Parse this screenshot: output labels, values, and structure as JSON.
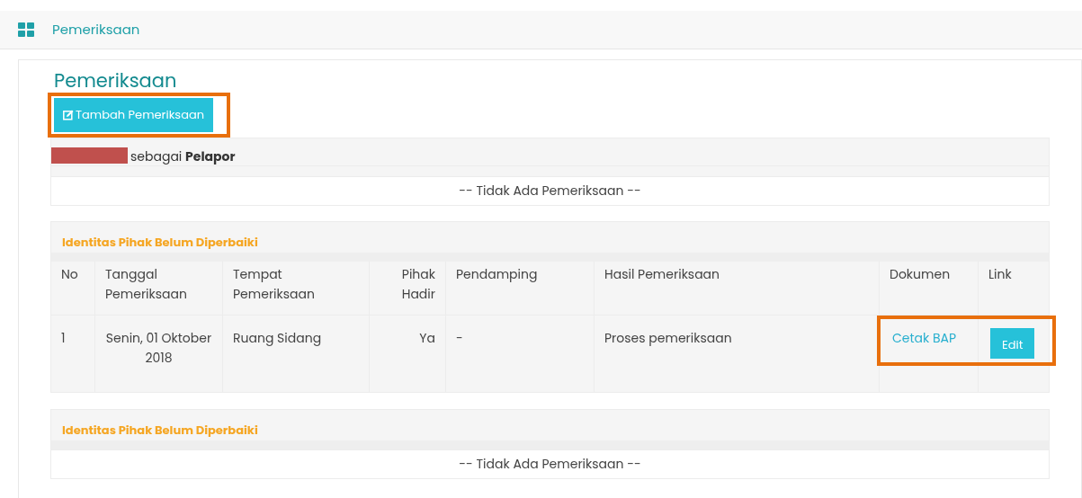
{
  "breadcrumb": {
    "label": "Pemeriksaan"
  },
  "page": {
    "title": "Pemeriksaan",
    "add_button": {
      "label": "Tambah Pemeriksaan",
      "highlighted": true
    }
  },
  "reporter": {
    "redacted": true,
    "text": "sebagai **Pelapor**",
    "empty_message": "-- Tidak Ada Pemeriksaan --"
  },
  "sections": [
    {
      "kind": "table",
      "title": "Identitas Pihak Belum Diperbaiki",
      "columns": [
        "No",
        "Tanggal Pemeriksaan",
        "Tempat Pemeriksaan",
        "Pihak Hadir",
        "Pendamping",
        "Hasil Pemeriksaan",
        "Dokumen",
        "Link"
      ],
      "rows": [
        {
          "no": "1",
          "date": "Senin, 01 Oktober 2018",
          "place": "Ruang Sidang",
          "present": "Ya",
          "companion": "-",
          "result": "Proses pemeriksaan",
          "document_link": "Cetak BAP",
          "edit_button": "Edit",
          "highlighted": true
        }
      ]
    },
    {
      "kind": "empty",
      "title": "Identitas Pihak Belum Diperbaiki",
      "empty_message": "-- Tidak Ada Pemeriksaan --"
    }
  ]
}
